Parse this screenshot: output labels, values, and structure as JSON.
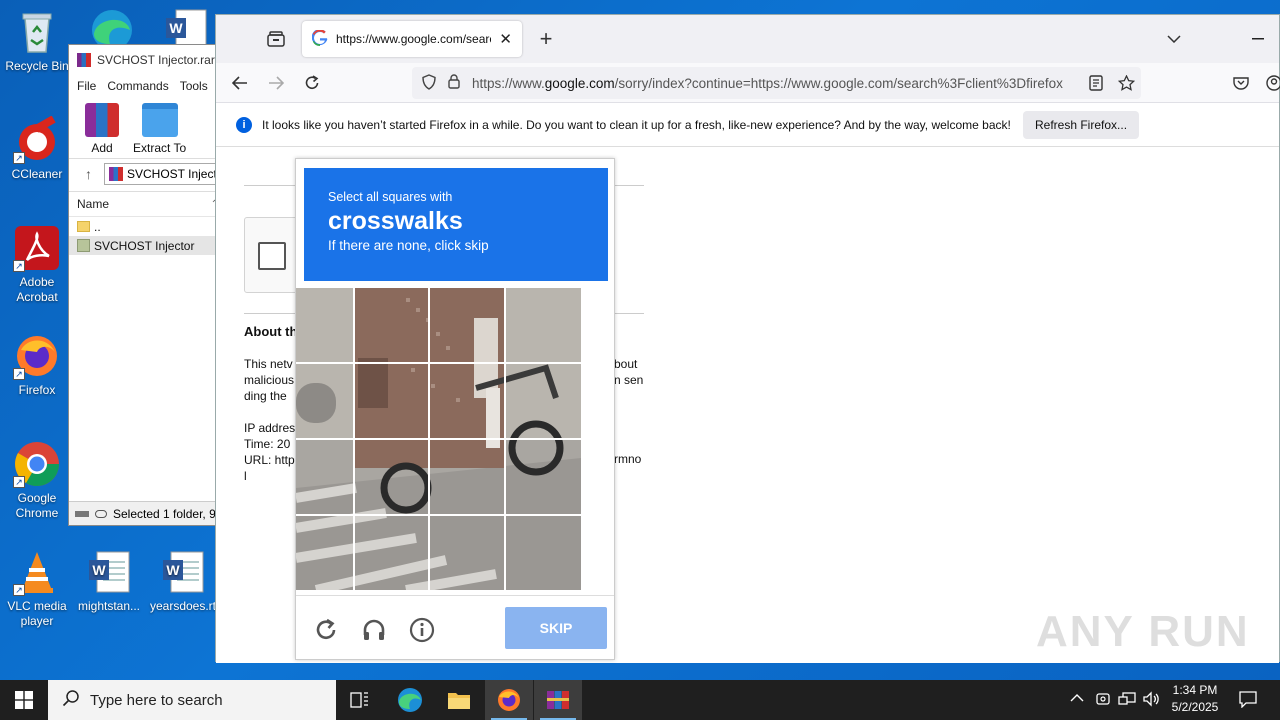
{
  "desktop": {
    "icons": [
      {
        "label": "Recycle Bin"
      },
      {
        "label": "CCleaner"
      },
      {
        "label": "Adobe Acrobat"
      },
      {
        "label": "Firefox"
      },
      {
        "label": "Google Chrome"
      },
      {
        "label": "VLC media player"
      },
      {
        "label": "mightstan..."
      },
      {
        "label": "yearsdoes.rt"
      }
    ]
  },
  "winrar": {
    "title": "SVCHOST Injector.rar",
    "menu": [
      "File",
      "Commands",
      "Tools"
    ],
    "toolbar": [
      "Add",
      "Extract To"
    ],
    "address": "SVCHOST Injector",
    "column_name": "Name",
    "rows": [
      "..",
      "SVCHOST Injector"
    ],
    "status": "Selected 1 folder, 9"
  },
  "firefox": {
    "tab_title": "https://www.google.com/searc",
    "url_prefix": "https://www.",
    "url_host": "google.com",
    "url_rest": "/sorry/index?continue=https://www.google.com/search%3Fclient%3Dfirefox",
    "notice_text": "It looks like you haven’t started Firefox in a while. Do you want to clean it up for a fresh, like-new experience? And by the way, welcome back!",
    "refresh_button": "Refresh Firefox..."
  },
  "page": {
    "about_heading": "About th",
    "para_left": [
      "This netv",
      "malicious",
      "ding the"
    ],
    "para_right": [
      "bout",
      "n sen"
    ],
    "ip_lines": [
      "IP addres",
      "Time: 20",
      "URL: http",
      "l"
    ],
    "url_right": "rmno"
  },
  "captcha": {
    "instruction": "Select all squares with",
    "target": "crosswalks",
    "hint": "If there are none, click skip",
    "skip_label": "SKIP"
  },
  "taskbar": {
    "search_placeholder": "Type here to search",
    "time": "1:34 PM",
    "date": "5/2/2025"
  },
  "watermark": "ANY RUN",
  "colors": {
    "captcha_blue": "#1a73e8",
    "skip_button": "#8ab4f0",
    "desktop": "#0d74d4",
    "taskbar": "#1f1f1f"
  }
}
